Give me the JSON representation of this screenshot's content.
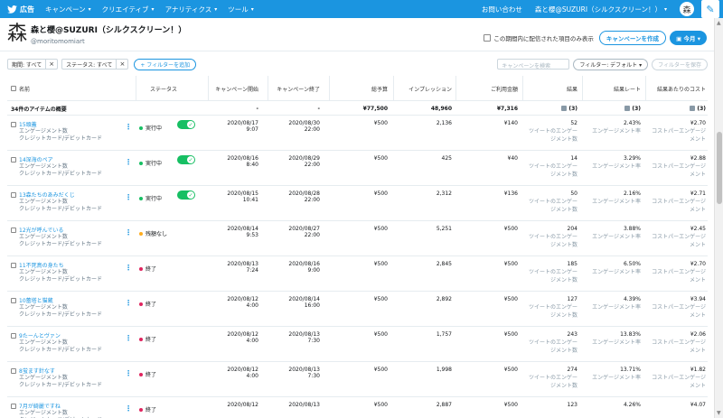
{
  "topnav": {
    "brand": "広告",
    "menu": [
      "キャンペーン",
      "クリエイティブ",
      "アナリティクス",
      "ツール"
    ],
    "help": "お問い合わせ",
    "account": "森と櫻@SUZURI（シルクスクリーン！）"
  },
  "account": {
    "logo": "森",
    "name": "森と櫻@SUZURI（シルクスクリーン！）",
    "handle": "@moritomomiart"
  },
  "header_right": {
    "checkbox_label": "この期間内に配信された項目のみ表示",
    "create_button": "キャンペーンを作成",
    "date_button": "今月"
  },
  "filters": {
    "chips": [
      "期間: すべて",
      "ステータス: すべて"
    ],
    "add_filter": "+ フィルターを追加",
    "search_placeholder": "キャンペーンを検索",
    "filter_default": "フィルター: デフォルト",
    "save_filter": "フィルターを保存"
  },
  "columns": {
    "name": "名前",
    "status": "ステータス",
    "start": "キャンペーン開始",
    "end": "キャンペーン終了",
    "budget": "総予算",
    "impressions": "インプレッション",
    "spend": "ご利用金額",
    "results": "結果",
    "result_rate": "結果レート",
    "cost_per_result": "結果あたりのコスト"
  },
  "summary": {
    "label": "34件のアイテムの概要",
    "start": "-",
    "end": "-",
    "budget": "¥77,500",
    "impressions": "48,960",
    "spend": "¥7,316",
    "results": "(3)",
    "result_rate": "(3)",
    "cost_per_result": "(3)"
  },
  "rows": [
    {
      "title": "15頭蓋",
      "type": "エンゲージメント数",
      "payment": "クレジットカード/デビットカード",
      "status": "実行中",
      "status_color": "#17bf63",
      "toggle": true,
      "start_date": "2020/08/17",
      "start_time": "9:07",
      "end_date": "2020/08/30",
      "end_time": "22:00",
      "budget": "¥500",
      "impressions": "2,136",
      "spend": "¥140",
      "results": "52",
      "results_sub": "ツイートのエンゲージメント数",
      "rate": "2.43%",
      "rate_sub": "エンゲージメント率",
      "cost": "¥2.70",
      "cost_sub": "コストパーエンゲージメント"
    },
    {
      "title": "14深海のペア",
      "type": "エンゲージメント数",
      "payment": "クレジットカード/デビットカード",
      "status": "実行中",
      "status_color": "#17bf63",
      "toggle": true,
      "start_date": "2020/08/16",
      "start_time": "8:40",
      "end_date": "2020/08/29",
      "end_time": "22:00",
      "budget": "¥500",
      "impressions": "425",
      "spend": "¥40",
      "results": "14",
      "results_sub": "ツイートのエンゲージメント数",
      "rate": "3.29%",
      "rate_sub": "エンゲージメント率",
      "cost": "¥2.88",
      "cost_sub": "コストパーエンゲージメント"
    },
    {
      "title": "13森たちのあみだくじ",
      "type": "エンゲージメント数",
      "payment": "クレジットカード/デビットカード",
      "status": "実行中",
      "status_color": "#17bf63",
      "toggle": true,
      "start_date": "2020/08/15",
      "start_time": "10:41",
      "end_date": "2020/08/28",
      "end_time": "22:00",
      "budget": "¥500",
      "impressions": "2,312",
      "spend": "¥136",
      "results": "50",
      "results_sub": "ツイートのエンゲージメント数",
      "rate": "2.16%",
      "rate_sub": "エンゲージメント率",
      "cost": "¥2.71",
      "cost_sub": "コストパーエンゲージメント"
    },
    {
      "title": "12光が呼んでいる",
      "type": "エンゲージメント数",
      "payment": "クレジットカード/デビットカード",
      "status": "残額なし",
      "status_color": "#ffad1f",
      "toggle": false,
      "start_date": "2020/08/14",
      "start_time": "9:53",
      "end_date": "2020/08/27",
      "end_time": "22:00",
      "budget": "¥500",
      "impressions": "5,251",
      "spend": "¥500",
      "results": "204",
      "results_sub": "ツイートのエンゲージメント数",
      "rate": "3.88%",
      "rate_sub": "エンゲージメント率",
      "cost": "¥2.45",
      "cost_sub": "コストパーエンゲージメント"
    },
    {
      "title": "11不死鳥の身たち",
      "type": "エンゲージメント数",
      "payment": "クレジットカード/デビットカード",
      "status": "終了",
      "status_color": "#e0245e",
      "toggle": false,
      "start_date": "2020/08/13",
      "start_time": "7:24",
      "end_date": "2020/08/16",
      "end_time": "9:00",
      "budget": "¥500",
      "impressions": "2,845",
      "spend": "¥500",
      "results": "185",
      "results_sub": "ツイートのエンゲージメント数",
      "rate": "6.50%",
      "rate_sub": "エンゲージメント率",
      "cost": "¥2.70",
      "cost_sub": "コストパーエンゲージメント"
    },
    {
      "title": "10蕾塔と猫蔵",
      "type": "エンゲージメント数",
      "payment": "クレジットカード/デビットカード",
      "status": "終了",
      "status_color": "#e0245e",
      "toggle": false,
      "start_date": "2020/08/12",
      "start_time": "4:00",
      "end_date": "2020/08/14",
      "end_time": "16:00",
      "budget": "¥500",
      "impressions": "2,892",
      "spend": "¥500",
      "results": "127",
      "results_sub": "ツイートのエンゲージメント数",
      "rate": "4.39%",
      "rate_sub": "エンゲージメント率",
      "cost": "¥3.94",
      "cost_sub": "コストパーエンゲージメント"
    },
    {
      "title": "9たーんとヴァン",
      "type": "エンゲージメント数",
      "payment": "クレジットカード/デビットカード",
      "status": "終了",
      "status_color": "#e0245e",
      "toggle": false,
      "start_date": "2020/08/12",
      "start_time": "4:00",
      "end_date": "2020/08/13",
      "end_time": "7:30",
      "budget": "¥500",
      "impressions": "1,757",
      "spend": "¥500",
      "results": "243",
      "results_sub": "ツイートのエンゲージメント数",
      "rate": "13.83%",
      "rate_sub": "エンゲージメント率",
      "cost": "¥2.06",
      "cost_sub": "コストパーエンゲージメント"
    },
    {
      "title": "8蛍ます針なす",
      "type": "エンゲージメント数",
      "payment": "クレジットカード/デビットカード",
      "status": "終了",
      "status_color": "#e0245e",
      "toggle": false,
      "start_date": "2020/08/12",
      "start_time": "4:00",
      "end_date": "2020/08/13",
      "end_time": "7:30",
      "budget": "¥500",
      "impressions": "1,998",
      "spend": "¥500",
      "results": "274",
      "results_sub": "ツイートのエンゲージメント数",
      "rate": "13.71%",
      "rate_sub": "エンゲージメント率",
      "cost": "¥1.82",
      "cost_sub": "コストパーエンゲージメント"
    },
    {
      "title": "7月が綺麗ですね",
      "type": "エンゲージメント数",
      "payment": "クレジットカード/デビットカード",
      "status": "終了",
      "status_color": "#e0245e",
      "toggle": false,
      "start_date": "2020/08/12",
      "start_time": "",
      "end_date": "2020/08/13",
      "end_time": "",
      "budget": "¥500",
      "impressions": "2,887",
      "spend": "¥500",
      "results": "123",
      "results_sub": "",
      "rate": "4.26%",
      "rate_sub": "",
      "cost": "¥4.07",
      "cost_sub": ""
    }
  ]
}
